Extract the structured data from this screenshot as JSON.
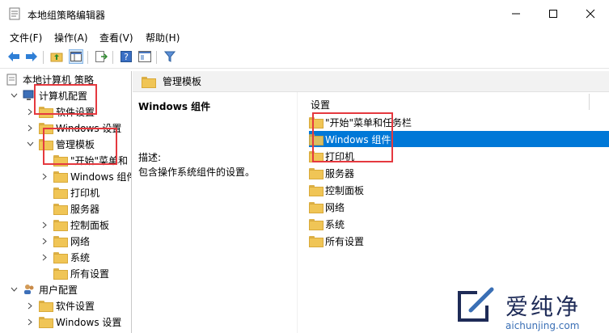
{
  "window": {
    "title": "本地组策略编辑器"
  },
  "menu": [
    "文件(F)",
    "操作(A)",
    "查看(V)",
    "帮助(H)"
  ],
  "tree": {
    "root": "本地计算机 策略",
    "computer_config": "计算机配置",
    "software_settings": "软件设置",
    "windows_settings": "Windows 设置",
    "admin_templates": "管理模板",
    "start_menu": "\"开始\"菜单和",
    "windows_components": "Windows 组件",
    "printer": "打印机",
    "server": "服务器",
    "control_panel": "控制面板",
    "network": "网络",
    "system": "系统",
    "all_settings": "所有设置",
    "user_config": "用户配置",
    "user_software_settings": "软件设置",
    "user_windows_settings": "Windows 设置"
  },
  "header": {
    "label": "管理模板"
  },
  "description": {
    "title": "Windows 组件",
    "label": "描述:",
    "text": "包含操作系统组件的设置。"
  },
  "settings": {
    "column": "设置",
    "items": [
      "\"开始\"菜单和任务栏",
      "Windows 组件",
      "打印机",
      "服务器",
      "控制面板",
      "网络",
      "系统",
      "所有设置"
    ]
  },
  "watermark": {
    "brand": "爱纯净",
    "url": "aichunjing.com"
  },
  "colors": {
    "selection": "#0078d7",
    "highlight_box": "#e5393f",
    "folder": "#f0c556"
  }
}
